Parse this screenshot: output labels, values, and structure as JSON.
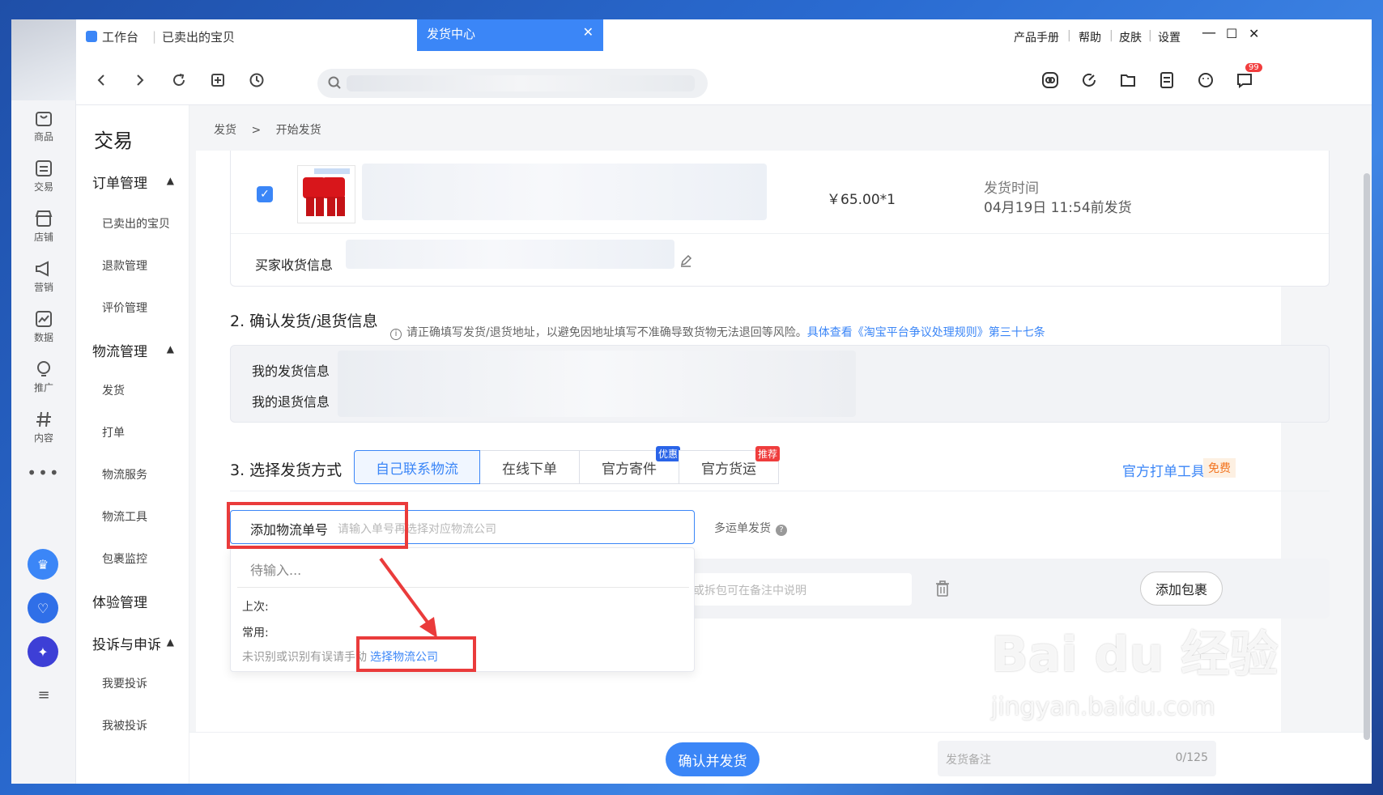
{
  "titlebar": {
    "tabs": [
      {
        "label": "工作台"
      },
      {
        "label": "已卖出的宝贝"
      }
    ],
    "active_tab": "发货中心",
    "menu": [
      "产品手册",
      "帮助",
      "皮肤",
      "设置"
    ]
  },
  "rail": {
    "items": [
      "商品",
      "交易",
      "店铺",
      "营销",
      "数据",
      "推广",
      "内容"
    ],
    "notification_count": "99"
  },
  "sidebar": {
    "title": "交易",
    "group_order": "订单管理",
    "group_order_items": [
      "已卖出的宝贝",
      "退款管理",
      "评价管理"
    ],
    "group_logistics": "物流管理",
    "group_logistics_items": [
      "发货",
      "打单",
      "物流服务",
      "物流工具",
      "包裹监控"
    ],
    "group_experience": "体验管理",
    "group_complaint": "投诉与申诉",
    "group_complaint_items": [
      "我要投诉",
      "我被投诉"
    ]
  },
  "breadcrumb": {
    "parent": "发货",
    "sep": ">",
    "current": "开始发货"
  },
  "product": {
    "price": "￥65.00*1",
    "ship_time_label": "发货时间",
    "ship_time": "04月19日 11:54前发货",
    "buyer_label": "买家收货信息"
  },
  "section2": {
    "title": "2. 确认发货/退货信息",
    "notice": "请正确填写发货/退货地址，以避免因地址填写不准确导致货物无法退回等风险。",
    "notice_link": "具体查看《淘宝平台争议处理规则》第三十七条",
    "send_label": "我的发货信息",
    "return_label": "我的退货信息"
  },
  "section3": {
    "title": "3. 选择发货方式",
    "methods": [
      "自己联系物流",
      "在线下单",
      "官方寄件",
      "官方货运"
    ],
    "badge_discount": "优惠",
    "badge_recommend": "推荐",
    "tool_link": "官方打单工具",
    "free_tag": "免费",
    "tracking_label": "添加物流单号",
    "tracking_placeholder": "请输入单号再选择对应物流公司",
    "multi_label": "多运单发货",
    "note_placeholder": "或拆包可在备注中说明",
    "add_package": "添加包裹"
  },
  "dropdown": {
    "waiting": "待输入...",
    "last_label": "上次:",
    "common_label": "常用:",
    "hint": "未识别或识别有误请手动",
    "select_link": "选择物流公司"
  },
  "footer": {
    "confirm": "确认并发货",
    "note_placeholder": "发货备注",
    "note_count": "0/125"
  },
  "watermark": {
    "brand": "Bai du 经验",
    "url": "jingyan.baidu.com"
  }
}
